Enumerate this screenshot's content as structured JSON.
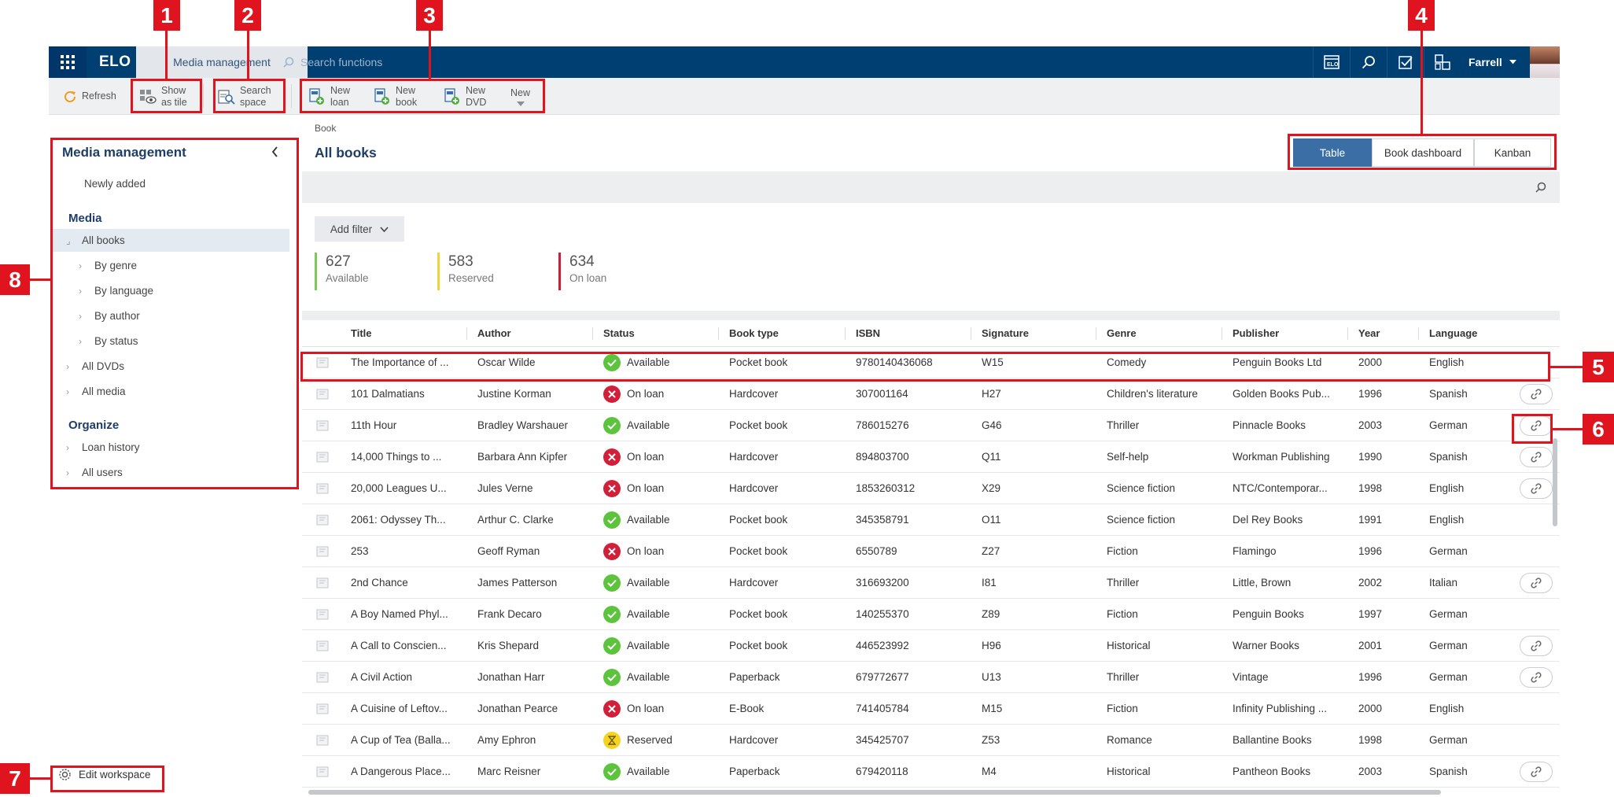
{
  "topbar": {
    "logo": "ELO",
    "active_tab": "Media management",
    "search_placeholder": "Search functions",
    "user": "Farrell"
  },
  "toolbar": {
    "refresh": "Refresh",
    "show_as_tile": [
      "Show",
      "as tile"
    ],
    "search_space": [
      "Search",
      "space"
    ],
    "new_loan": [
      "New",
      "loan"
    ],
    "new_book": [
      "New",
      "book"
    ],
    "new_dvd": [
      "New",
      "DVD"
    ],
    "new": "New"
  },
  "sidebar": {
    "title": "Media management",
    "newly_added": "Newly added",
    "media_heading": "Media",
    "all_books": "All books",
    "by_genre": "By genre",
    "by_language": "By language",
    "by_author": "By author",
    "by_status": "By status",
    "all_dvds": "All DVDs",
    "all_media": "All media",
    "organize_heading": "Organize",
    "loan_history": "Loan history",
    "all_users": "All users",
    "edit_workspace": "Edit workspace"
  },
  "main": {
    "breadcrumb": "Book",
    "title": "All books",
    "views": [
      "Table",
      "Book dashboard",
      "Kanban"
    ],
    "active_view": "Table",
    "add_filter": "Add filter",
    "kpis": [
      {
        "value": "627",
        "label": "Available",
        "color": "#7cc95a"
      },
      {
        "value": "583",
        "label": "Reserved",
        "color": "#f2d43a"
      },
      {
        "value": "634",
        "label": "On loan",
        "color": "#c8203b"
      }
    ]
  },
  "table": {
    "columns": [
      "Title",
      "Author",
      "Status",
      "Book type",
      "ISBN",
      "Signature",
      "Genre",
      "Publisher",
      "Year",
      "Language"
    ],
    "rows": [
      {
        "title": "The Importance of ...",
        "author": "Oscar Wilde",
        "status": "Available",
        "type": "Pocket book",
        "isbn": "9780140436068",
        "sig": "W15",
        "genre": "Comedy",
        "publisher": "Penguin Books Ltd",
        "year": "2000",
        "lang": "English",
        "link": false
      },
      {
        "title": "101 Dalmatians",
        "author": "Justine Korman",
        "status": "On loan",
        "type": "Hardcover",
        "isbn": "307001164",
        "sig": "H27",
        "genre": "Children's literature",
        "publisher": "Golden Books Pub...",
        "year": "1996",
        "lang": "Spanish",
        "link": true
      },
      {
        "title": "11th Hour",
        "author": "Bradley Warshauer",
        "status": "Available",
        "type": "Pocket book",
        "isbn": "786015276",
        "sig": "G46",
        "genre": "Thriller",
        "publisher": "Pinnacle Books",
        "year": "2003",
        "lang": "German",
        "link": true
      },
      {
        "title": "14,000 Things to ...",
        "author": "Barbara Ann Kipfer",
        "status": "On loan",
        "type": "Hardcover",
        "isbn": "894803700",
        "sig": "Q11",
        "genre": "Self-help",
        "publisher": "Workman Publishing",
        "year": "1990",
        "lang": "Spanish",
        "link": true
      },
      {
        "title": "20,000 Leagues U...",
        "author": "Jules Verne",
        "status": "On loan",
        "type": "Hardcover",
        "isbn": "1853260312",
        "sig": "X29",
        "genre": "Science fiction",
        "publisher": "NTC/Contemporar...",
        "year": "1998",
        "lang": "English",
        "link": true
      },
      {
        "title": "2061: Odyssey Th...",
        "author": "Arthur C. Clarke",
        "status": "Available",
        "type": "Pocket book",
        "isbn": "345358791",
        "sig": "O11",
        "genre": "Science fiction",
        "publisher": "Del Rey Books",
        "year": "1991",
        "lang": "English",
        "link": false
      },
      {
        "title": "253",
        "author": "Geoff Ryman",
        "status": "On loan",
        "type": "Pocket book",
        "isbn": "6550789",
        "sig": "Z27",
        "genre": "Fiction",
        "publisher": "Flamingo",
        "year": "1996",
        "lang": "German",
        "link": false
      },
      {
        "title": "2nd Chance",
        "author": "James Patterson",
        "status": "Available",
        "type": "Hardcover",
        "isbn": "316693200",
        "sig": "I81",
        "genre": "Thriller",
        "publisher": "Little, Brown",
        "year": "2002",
        "lang": "Italian",
        "link": true
      },
      {
        "title": "A Boy Named Phyl...",
        "author": "Frank Decaro",
        "status": "Available",
        "type": "Pocket book",
        "isbn": "140255370",
        "sig": "Z89",
        "genre": "Fiction",
        "publisher": "Penguin Books",
        "year": "1997",
        "lang": "German",
        "link": false
      },
      {
        "title": "A Call to Conscien...",
        "author": "Kris Shepard",
        "status": "Available",
        "type": "Pocket book",
        "isbn": "446523992",
        "sig": "H96",
        "genre": "Historical",
        "publisher": "Warner Books",
        "year": "2001",
        "lang": "German",
        "link": true
      },
      {
        "title": "A Civil Action",
        "author": "Jonathan Harr",
        "status": "Available",
        "type": "Paperback",
        "isbn": "679772677",
        "sig": "U13",
        "genre": "Thriller",
        "publisher": "Vintage",
        "year": "1996",
        "lang": "German",
        "link": true
      },
      {
        "title": "A Cuisine of Leftov...",
        "author": "Jonathan Pearce",
        "status": "On loan",
        "type": "E-Book",
        "isbn": "741405784",
        "sig": "M15",
        "genre": "Fiction",
        "publisher": "Infinity Publishing ...",
        "year": "2000",
        "lang": "English",
        "link": false
      },
      {
        "title": "A Cup of Tea (Balla...",
        "author": "Amy Ephron",
        "status": "Reserved",
        "type": "Hardcover",
        "isbn": "345425707",
        "sig": "Z53",
        "genre": "Romance",
        "publisher": "Ballantine Books",
        "year": "1998",
        "lang": "German",
        "link": false
      },
      {
        "title": "A Dangerous Place...",
        "author": "Marc Reisner",
        "status": "Available",
        "type": "Paperback",
        "isbn": "679420118",
        "sig": "M4",
        "genre": "Historical",
        "publisher": "Pantheon Books",
        "year": "2003",
        "lang": "Spanish",
        "link": true
      }
    ]
  },
  "annotations": [
    "1",
    "2",
    "3",
    "4",
    "5",
    "6",
    "7",
    "8"
  ],
  "colors": {
    "available": "#5cc33d",
    "on_loan": "#d3203a",
    "reserved": "#f5d320",
    "annotation": "#e0141e"
  }
}
